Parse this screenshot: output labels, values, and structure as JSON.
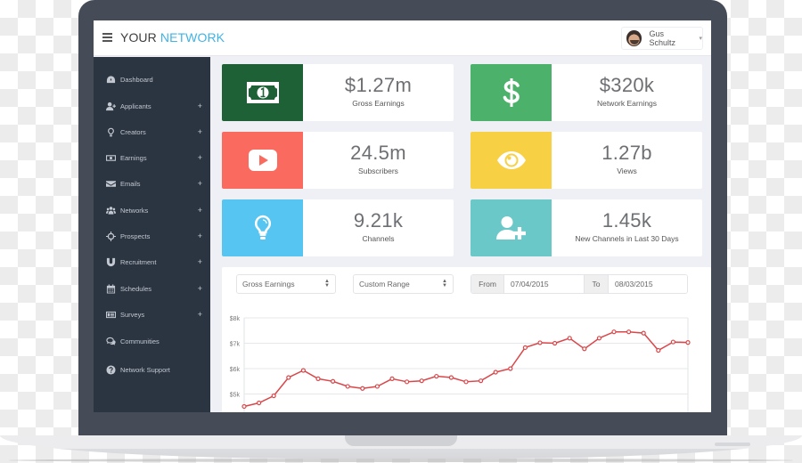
{
  "header": {
    "brand_part1": "YOUR",
    "brand_part2": "NETWORK",
    "brand_accent_color": "#3fb3e6",
    "user_name": "Gus Schultz",
    "user_caret": "▾"
  },
  "sidebar": {
    "items": [
      {
        "label": "Dashboard",
        "icon": "dashboard-icon",
        "expandable": false
      },
      {
        "label": "Applicants",
        "icon": "add-user-icon",
        "expandable": true
      },
      {
        "label": "Creators",
        "icon": "lightbulb-icon",
        "expandable": true
      },
      {
        "label": "Earnings",
        "icon": "money-icon",
        "expandable": true
      },
      {
        "label": "Emails",
        "icon": "envelope-icon",
        "expandable": true
      },
      {
        "label": "Networks",
        "icon": "users-icon",
        "expandable": true
      },
      {
        "label": "Prospects",
        "icon": "crosshairs-icon",
        "expandable": true
      },
      {
        "label": "Recruitment",
        "icon": "magnet-icon",
        "expandable": true
      },
      {
        "label": "Schedules",
        "icon": "calendar-icon",
        "expandable": true
      },
      {
        "label": "Surveys",
        "icon": "list-alt-icon",
        "expandable": true
      },
      {
        "label": "Communities",
        "icon": "comments-icon",
        "expandable": false
      },
      {
        "label": "Network Support",
        "icon": "question-circle-icon",
        "expandable": false
      }
    ],
    "expand_glyph": "+"
  },
  "stats": [
    {
      "value": "$1.27m",
      "label": "Gross Earnings",
      "icon": "money-bill-icon",
      "color": "#1e6137"
    },
    {
      "value": "$320k",
      "label": "Network Earnings",
      "icon": "dollar-icon",
      "color": "#4cb26b"
    },
    {
      "value": "24.5m",
      "label": "Subscribers",
      "icon": "youtube-play-icon",
      "color": "#fb6a5e"
    },
    {
      "value": "1.27b",
      "label": "Views",
      "icon": "eye-icon",
      "color": "#f8d044"
    },
    {
      "value": "9.21k",
      "label": "Channels",
      "icon": "lightbulb-icon",
      "color": "#56c5f2"
    },
    {
      "value": "1.45k",
      "label": "New Channels in Last 30 Days",
      "icon": "user-plus-icon",
      "color": "#6ac9c8"
    }
  ],
  "filters": {
    "metric_select": "Gross Earnings",
    "range_select": "Custom Range",
    "from_label": "From",
    "from_value": "07/04/2015",
    "to_label": "To",
    "to_value": "08/03/2015"
  },
  "chart_data": {
    "type": "line",
    "title": "",
    "xlabel": "",
    "ylabel": "",
    "y_ticks": [
      "$5k",
      "$6k",
      "$7k",
      "$8k"
    ],
    "y_tick_values": [
      5000,
      6000,
      7000,
      8000
    ],
    "ylim": [
      4000,
      8000
    ],
    "grid": true,
    "line_color": "#d9474a",
    "series": [
      {
        "name": "Gross Earnings",
        "values": [
          4510,
          4650,
          4930,
          5650,
          5930,
          5600,
          5500,
          5300,
          5220,
          5300,
          5600,
          5480,
          5520,
          5700,
          5650,
          5480,
          5520,
          5860,
          6000,
          6830,
          7020,
          7000,
          7200,
          6780,
          7200,
          7450,
          7450,
          7400,
          6720,
          7050,
          7030
        ]
      }
    ]
  }
}
